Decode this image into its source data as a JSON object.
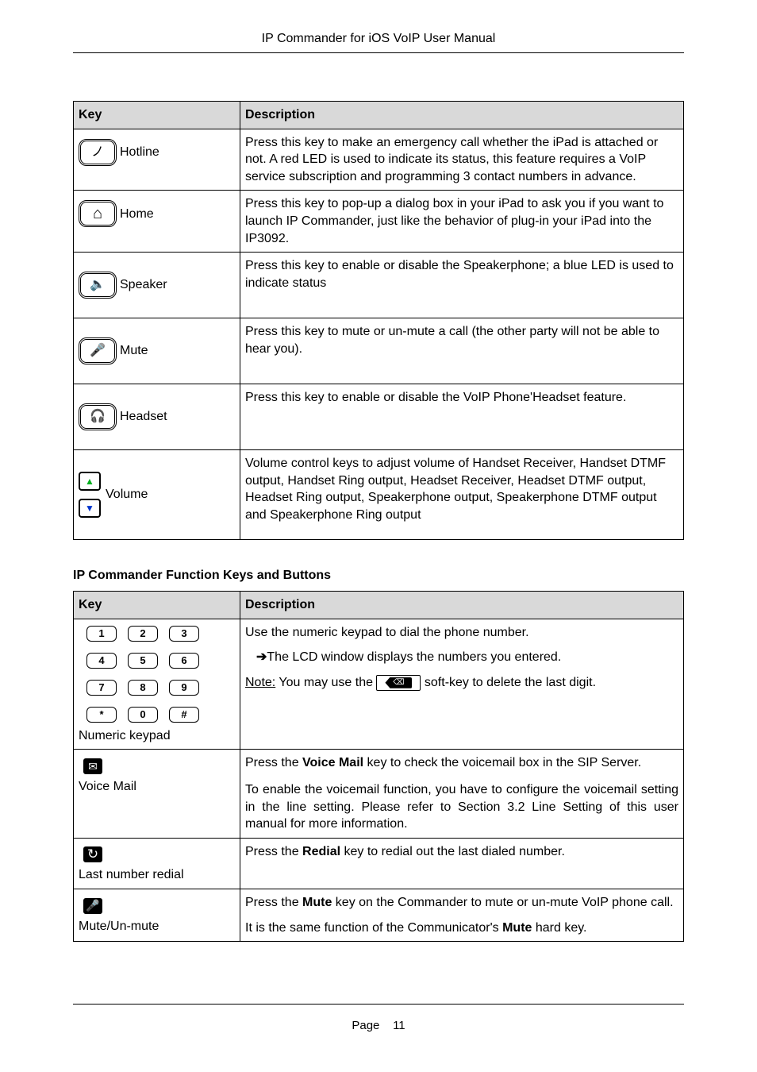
{
  "header": "IP Commander for iOS VoIP User Manual",
  "table1": {
    "head": {
      "c1": "Key",
      "c2": "Description"
    },
    "rows": [
      {
        "label": "Hotline",
        "name": "hotline-key",
        "icon": "hotline-icon",
        "glyph": "ノ",
        "desc": "Press this key to make an emergency call whether the iPad is attached or not.    A red LED is used to indicate its status, this feature requires a VoIP service subscription and programming 3 contact numbers in advance."
      },
      {
        "label": "Home",
        "name": "home-key",
        "icon": "home-icon",
        "glyph": "⌂",
        "desc": "Press this key to pop-up a dialog box in your iPad to ask you if you want to launch IP Commander, just like the behavior of plug-in your iPad into the IP3092."
      },
      {
        "label": "Speaker",
        "name": "speaker-key",
        "icon": "speaker-icon",
        "glyph": "🔈",
        "desc": "Press this key to enable or disable the Speakerphone; a blue LED is used to indicate status"
      },
      {
        "label": "Mute",
        "name": "mute-key",
        "icon": "mute-icon",
        "glyph": "🎤",
        "desc": "Press this key to mute or un-mute a call (the other party will not be able to hear you)."
      },
      {
        "label": "Headset",
        "name": "headset-key",
        "icon": "headset-icon",
        "glyph": "🎧",
        "desc": "Press this key to enable or disable the VoIP Phone'Headset feature."
      },
      {
        "label": "Volume",
        "name": "volume-key",
        "iconUp": "volume-up-icon",
        "iconDn": "volume-down-icon",
        "glyphUp": "▲",
        "glyphDn": "▼",
        "desc": "Volume control keys to adjust volume of Handset Receiver, Handset DTMF output, Handset Ring output, Headset Receiver, Headset DTMF output, Headset Ring output, Speakerphone output, Speakerphone DTMF output and Speakerphone Ring output"
      }
    ]
  },
  "sectionTitle": "IP Commander Function Keys and Buttons",
  "table2": {
    "head": {
      "c1": "Key",
      "c2": "Description"
    },
    "keypad": {
      "label": "Numeric keypad",
      "keys": [
        "1",
        "2",
        "3",
        "4",
        "5",
        "6",
        "7",
        "8",
        "9",
        "*",
        "0",
        "#"
      ],
      "line1": "Use the numeric keypad to dial the phone number.",
      "line2": "The LCD window displays the numbers you entered.",
      "notePrefix": "Note:",
      "noteMid": " You may use the ",
      "noteSuffix": " soft-key to delete the last digit.",
      "bsGlyph": "⌫"
    },
    "voicemail": {
      "label": "Voice Mail",
      "glyph": "✉",
      "line1a": "Press the ",
      "line1b": "Voice Mail",
      "line1c": " key to check the voicemail box in the SIP Server.",
      "line2": "To enable the voicemail function, you have to configure the voicemail setting in the line setting.  Please refer to Section 3.2 Line Setting of this user manual for more information."
    },
    "redial": {
      "label": "Last number redial",
      "glyph": "↻",
      "text1": "Press the ",
      "bold": "Redial",
      "text2": " key to redial out the last dialed number."
    },
    "mute": {
      "label": "Mute/Un-mute",
      "glyph": "🎤",
      "l1a": "Press the ",
      "l1b": "Mute",
      "l1c": " key on the Commander to mute or un-mute VoIP phone call.",
      "l2a": "It is the same function of the Communicator's ",
      "l2b": "Mute",
      "l2c": " hard key."
    }
  },
  "footer": {
    "page": "Page",
    "num": "11"
  }
}
